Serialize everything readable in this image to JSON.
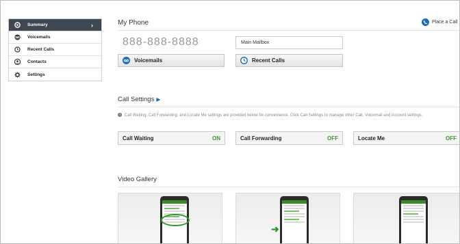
{
  "sidebar": {
    "items": [
      {
        "label": "Summary",
        "icon": "circle-dot-icon",
        "active": true
      },
      {
        "label": "Voicemails",
        "icon": "voicemail-icon",
        "active": false
      },
      {
        "label": "Recent Calls",
        "icon": "clock-icon",
        "active": false
      },
      {
        "label": "Contacts",
        "icon": "contact-icon",
        "active": false
      },
      {
        "label": "Settings",
        "icon": "gear-icon",
        "active": false
      }
    ],
    "active_chevron": "›"
  },
  "my_phone": {
    "title": "My Phone",
    "number": "888-888-8888",
    "mailbox_value": "Main Mailbox",
    "voicemails_button": "Voicemails",
    "recent_calls_button": "Recent Calls",
    "place_call": "Place a Call"
  },
  "call_settings": {
    "title": "Call Settings",
    "note": "Call Waiting, Call Forwarding, and Locate Me settings are provided below for convenience. Click Call Settings to manage other Call, Voicemail and Account settings.",
    "toggles": [
      {
        "label": "Call Waiting",
        "state": "ON"
      },
      {
        "label": "Call Forwarding",
        "state": "OFF"
      },
      {
        "label": "Locate Me",
        "state": "OFF"
      }
    ]
  },
  "video_gallery": {
    "title": "Video Gallery"
  },
  "colors": {
    "sidebar_active": "#3f4753",
    "accent_blue": "#1f6fb5",
    "status_green": "#3a9a2a"
  }
}
